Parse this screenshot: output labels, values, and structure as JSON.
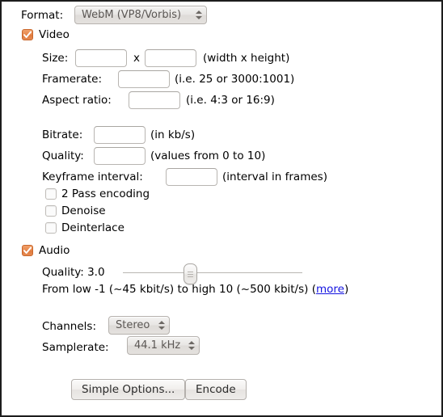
{
  "dialog": {
    "format_label": "Format:",
    "format_value": "WebM (VP8/Vorbis)"
  },
  "video": {
    "section_label": "Video",
    "enabled": true,
    "size_label": "Size:",
    "size_width_value": "",
    "size_separator": "x",
    "size_height_value": "",
    "size_hint": "(width x height)",
    "framerate_label": "Framerate:",
    "framerate_value": "",
    "framerate_hint": "(i.e. 25 or 3000:1001)",
    "aspect_label": "Aspect ratio:",
    "aspect_value": "",
    "aspect_hint": "(i.e. 4:3 or 16:9)",
    "bitrate_label": "Bitrate:",
    "bitrate_value": "",
    "bitrate_hint": "(in kb/s)",
    "quality_label": "Quality:",
    "quality_value": "",
    "quality_hint": "(values from 0 to 10)",
    "keyframe_label": "Keyframe interval:",
    "keyframe_value": "",
    "keyframe_hint": "(interval in frames)",
    "checkboxes": [
      {
        "label": "2 Pass encoding",
        "checked": false
      },
      {
        "label": "Denoise",
        "checked": false
      },
      {
        "label": "Deinterlace",
        "checked": false
      }
    ]
  },
  "audio": {
    "section_label": "Audio",
    "enabled": true,
    "quality_label": "Quality: 3.0",
    "quality_value": 3.0,
    "quality_min": -1,
    "quality_max": 10,
    "range_text_before": "From low -1 (~45 kbit/s) to high 10 (~500 kbit/s) (",
    "range_link": "more",
    "range_text_after": ")",
    "channels_label": "Channels:",
    "channels_value": "Stereo",
    "samplerate_label": "Samplerate:",
    "samplerate_value": "44.1 kHz"
  },
  "footer": {
    "simple_options_label": "Simple Options...",
    "encode_label": "Encode"
  },
  "colors": {
    "checkbox_accent": "#e8884d",
    "link": "#1414e0",
    "border": "#1c1c1c"
  }
}
